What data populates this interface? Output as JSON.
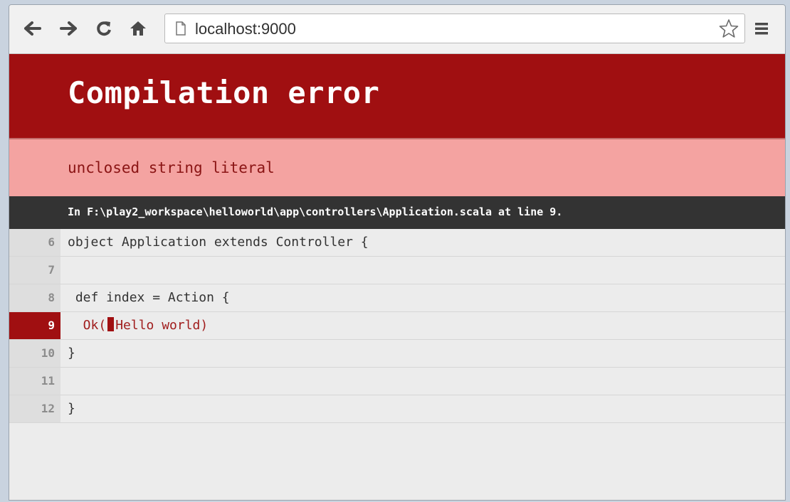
{
  "browser": {
    "url": "localhost:9000",
    "icons": [
      "back-arrow-icon",
      "forward-arrow-icon",
      "reload-icon",
      "home-icon",
      "page-icon",
      "star-icon",
      "menu-icon"
    ]
  },
  "error": {
    "title": "Compilation error",
    "message": "unclosed string literal",
    "location": "In F:\\play2_workspace\\helloworld\\app\\controllers\\Application.scala at line 9."
  },
  "code": {
    "lines": [
      {
        "num": "6",
        "text": "object Application extends Controller {"
      },
      {
        "num": "7",
        "text": ""
      },
      {
        "num": "8",
        "text": " def index = Action {"
      },
      {
        "num": "9",
        "text_before": "  Ok(",
        "text_after": "Hello world)"
      },
      {
        "num": "10",
        "text": "}"
      },
      {
        "num": "11",
        "text": ""
      },
      {
        "num": "12",
        "text": "}"
      }
    ]
  },
  "colors": {
    "header_bg": "#a00f11",
    "message_bg": "#f4a3a1",
    "location_bg": "#333333"
  }
}
